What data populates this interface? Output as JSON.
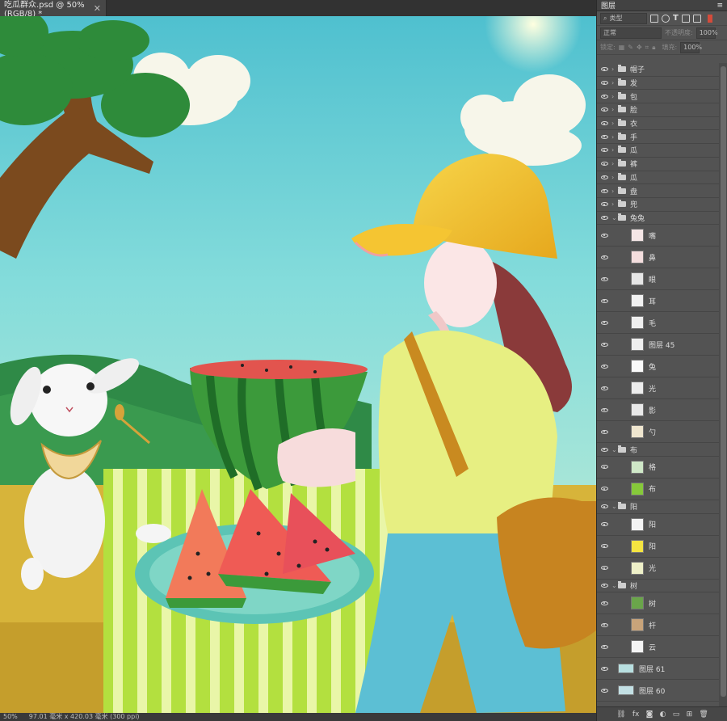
{
  "document": {
    "tab_title": "吃瓜群众.psd @ 50%(RGB/8) *",
    "close_glyph": "✕"
  },
  "status": {
    "zoom": "50%",
    "doc_info": "97.01 毫米 x 420.03 毫米 (300 ppi)"
  },
  "panel": {
    "title": "图层",
    "filter_label": "类型",
    "blend_mode": "正常",
    "opacity_label": "不透明度:",
    "opacity_value": "100%",
    "lock_label": "锁定:",
    "fill_label": "填充:",
    "fill_value": "100%"
  },
  "layers": [
    {
      "name": "帽子",
      "type": "group",
      "depth": 0
    },
    {
      "name": "发",
      "type": "group",
      "depth": 0
    },
    {
      "name": "包",
      "type": "group",
      "depth": 0
    },
    {
      "name": "脸",
      "type": "group",
      "depth": 0
    },
    {
      "name": "衣",
      "type": "group",
      "depth": 0
    },
    {
      "name": "手",
      "type": "group",
      "depth": 0
    },
    {
      "name": "瓜",
      "type": "group",
      "depth": 0
    },
    {
      "name": "裤",
      "type": "group",
      "depth": 0
    },
    {
      "name": "瓜",
      "type": "group",
      "depth": 0
    },
    {
      "name": "盘",
      "type": "group",
      "depth": 0
    },
    {
      "name": "兜",
      "type": "group",
      "depth": 0
    },
    {
      "name": "兔兔",
      "type": "group-open",
      "depth": 0
    },
    {
      "name": "嘴",
      "type": "layer",
      "depth": 1,
      "thumb": "#f5e6e6"
    },
    {
      "name": "鼻",
      "type": "layer",
      "depth": 1,
      "thumb": "#f4dede"
    },
    {
      "name": "眼",
      "type": "layer",
      "depth": 1,
      "thumb": "#e6e6e6"
    },
    {
      "name": "耳",
      "type": "layer",
      "depth": 1,
      "thumb": "#f2f2f2"
    },
    {
      "name": "毛",
      "type": "layer",
      "depth": 1,
      "thumb": "#f0f0f0"
    },
    {
      "name": "图层 45",
      "type": "layer",
      "depth": 1,
      "thumb": "#efefef"
    },
    {
      "name": "兔",
      "type": "layer",
      "depth": 1,
      "thumb": "#fafafa"
    },
    {
      "name": "光",
      "type": "layer",
      "depth": 1,
      "thumb": "#ededed"
    },
    {
      "name": "影",
      "type": "layer",
      "depth": 1,
      "thumb": "#e9e9e9"
    },
    {
      "name": "勺",
      "type": "layer",
      "depth": 1,
      "thumb": "#efe6cf"
    },
    {
      "name": "布",
      "type": "group-open",
      "depth": 0
    },
    {
      "name": "格",
      "type": "layer",
      "depth": 1,
      "thumb": "#cfe8c8"
    },
    {
      "name": "布",
      "type": "layer",
      "depth": 1,
      "thumb": "#86c93a"
    },
    {
      "name": "阳",
      "type": "group-open",
      "depth": 0
    },
    {
      "name": "阳",
      "type": "layer",
      "depth": 1,
      "thumb": "#f3f3f3"
    },
    {
      "name": "阳",
      "type": "layer",
      "depth": 1,
      "thumb": "#f5e541"
    },
    {
      "name": "光",
      "type": "layer",
      "depth": 1,
      "thumb": "#eef0c8"
    },
    {
      "name": "树",
      "type": "group-open",
      "depth": 0
    },
    {
      "name": "树",
      "type": "layer",
      "depth": 1,
      "thumb": "#6aa54a"
    },
    {
      "name": "杆",
      "type": "layer",
      "depth": 1,
      "thumb": "#c9a47a"
    },
    {
      "name": "云",
      "type": "layer",
      "depth": 1,
      "thumb": "#f5f5f5"
    },
    {
      "name": "图层 61",
      "type": "layer",
      "depth": 0,
      "thumb": "#b8dfe0"
    },
    {
      "name": "图层 60",
      "type": "layer",
      "depth": 0,
      "thumb": "#c3e0e4"
    }
  ],
  "colors": {
    "sky": "#6fd0d6",
    "grass": "#3c8f3a",
    "cap": "#f2c12e",
    "shirt": "#e5ef7a",
    "jeans": "#5bbfd3"
  }
}
